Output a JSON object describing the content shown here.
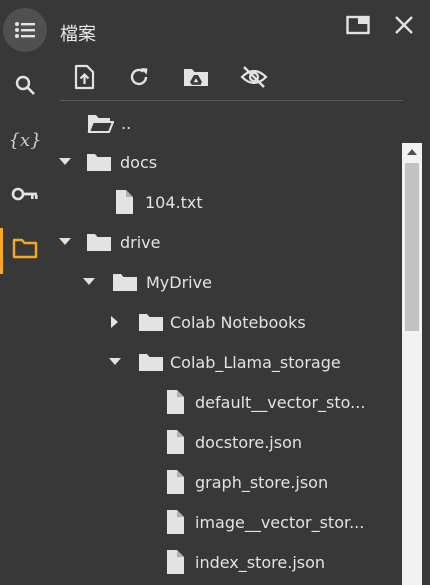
{
  "panel": {
    "title": "檔案"
  },
  "rail": {
    "items": [
      {
        "name": "table-of-contents",
        "icon": "list-icon"
      },
      {
        "name": "search",
        "icon": "search-icon"
      },
      {
        "name": "variables",
        "icon": "variables-icon",
        "text": "{x}"
      },
      {
        "name": "secrets",
        "icon": "key-icon"
      },
      {
        "name": "files",
        "icon": "folder-icon",
        "active": true
      }
    ],
    "active_color": "#f9a825"
  },
  "toolbar": {
    "items": [
      "upload-icon",
      "refresh-icon",
      "drive-folder-icon",
      "hide-icon"
    ]
  },
  "tree": {
    "parent_label": "..",
    "rows": [
      {
        "label": "docs",
        "type": "folder",
        "expanded": true
      },
      {
        "label": "104.txt",
        "type": "file"
      },
      {
        "label": "drive",
        "type": "folder",
        "expanded": true
      },
      {
        "label": "MyDrive",
        "type": "folder",
        "expanded": true
      },
      {
        "label": "Colab Notebooks",
        "type": "folder",
        "expanded": false
      },
      {
        "label": "Colab_Llama_storage",
        "type": "folder",
        "expanded": true
      },
      {
        "label": "default__vector_sto...",
        "type": "file"
      },
      {
        "label": "docstore.json",
        "type": "file"
      },
      {
        "label": "graph_store.json",
        "type": "file"
      },
      {
        "label": "image__vector_stor...",
        "type": "file"
      },
      {
        "label": "index_store.json",
        "type": "file"
      }
    ]
  },
  "scrollbar": {
    "position": 0.0,
    "visible_fraction": 0.38
  }
}
